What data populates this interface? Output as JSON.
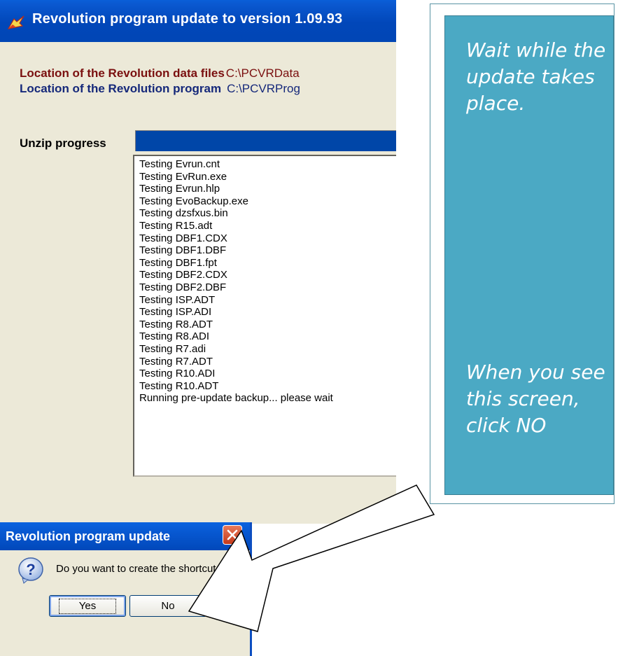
{
  "main_window": {
    "title": "Revolution program update to version 1.09.93",
    "data_location_label": "Location of the Revolution data files",
    "data_location_value": "C:\\PCVRData",
    "program_location_label": "Location of the Revolution program",
    "program_location_value": "C:\\PCVRProg",
    "unzip_label": "Unzip progress",
    "log_lines": [
      "Testing Evrun.cnt",
      "Testing EvRun.exe",
      "Testing Evrun.hlp",
      "Testing EvoBackup.exe",
      "Testing dzsfxus.bin",
      "Testing R15.adt",
      "Testing DBF1.CDX",
      "Testing DBF1.DBF",
      "Testing DBF1.fpt",
      "Testing DBF2.CDX",
      "Testing DBF2.DBF",
      "Testing ISP.ADT",
      "Testing ISP.ADI",
      "Testing R8.ADT",
      "Testing R8.ADI",
      "Testing R7.adi",
      "Testing R7.ADT",
      "Testing R10.ADI",
      "Testing R10.ADT",
      "Running pre-update backup... please wait"
    ]
  },
  "callout": {
    "top_text": "Wait while the update takes place.",
    "bottom_text": "When you see this screen, click NO"
  },
  "dialog": {
    "title": "Revolution program update",
    "message": "Do you want to create the shortcut",
    "yes_label": "Yes",
    "no_label": "No",
    "icon": "question-icon"
  },
  "colors": {
    "titlebar": "#0146b5",
    "window_bg": "#ece9d8",
    "callout_bg": "#4ba9c4",
    "data_location": "#7a0f0f",
    "program_location": "#15287a"
  }
}
